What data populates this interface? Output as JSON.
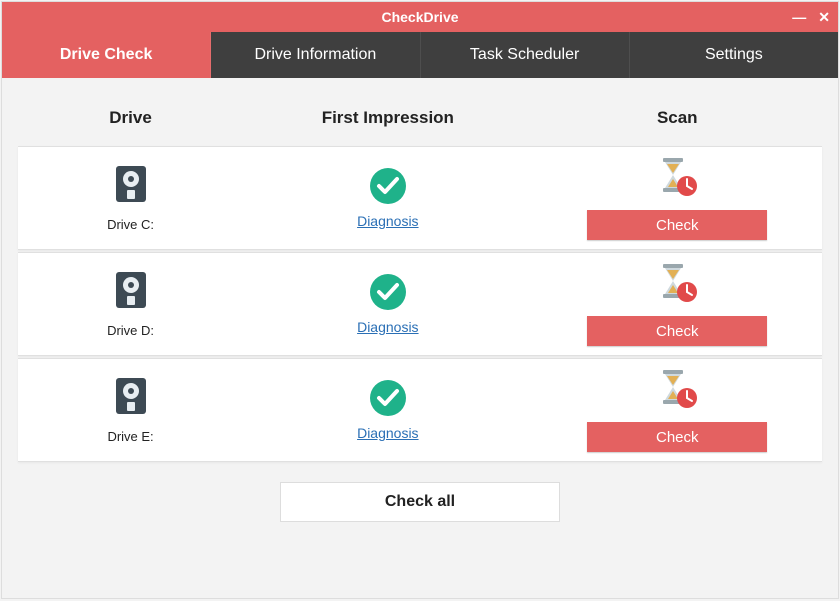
{
  "title": "CheckDrive",
  "tabs": [
    {
      "label": "Drive Check",
      "active": true
    },
    {
      "label": "Drive Information",
      "active": false
    },
    {
      "label": "Task Scheduler",
      "active": false
    },
    {
      "label": "Settings",
      "active": false
    }
  ],
  "columns": {
    "drive": "Drive",
    "impression": "First Impression",
    "scan": "Scan"
  },
  "drives": [
    {
      "label": "Drive C:",
      "diagnosis_label": "Diagnosis",
      "check_label": "Check"
    },
    {
      "label": "Drive D:",
      "diagnosis_label": "Diagnosis",
      "check_label": "Check"
    },
    {
      "label": "Drive E:",
      "diagnosis_label": "Diagnosis",
      "check_label": "Check"
    }
  ],
  "footer": {
    "check_all_label": "Check all"
  },
  "colors": {
    "accent": "#e46161",
    "tab_inactive": "#3f3f3f",
    "ok_green": "#1fb28a",
    "link_blue": "#2a6fb5"
  }
}
